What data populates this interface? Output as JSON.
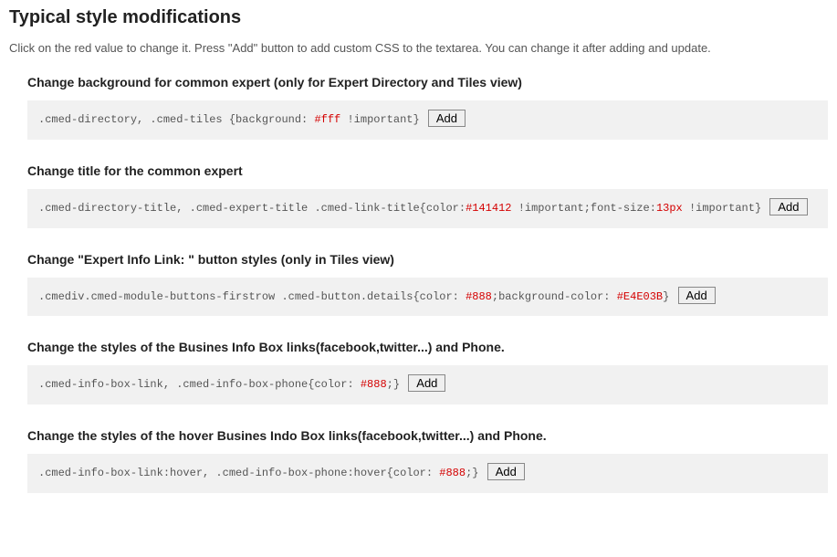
{
  "page": {
    "title": "Typical style modifications",
    "intro": "Click on the red value to change it. Press \"Add\" button to add custom CSS to the textarea. You can change it after adding and update."
  },
  "buttons": {
    "add": "Add"
  },
  "sections": [
    {
      "title": "Change background for common expert (only for Expert Directory and Tiles view)",
      "fragments": [
        {
          "type": "text",
          "value": ".cmed-directory, .cmed-tiles {background: "
        },
        {
          "type": "red",
          "value": "#fff"
        },
        {
          "type": "text",
          "value": " !important}"
        }
      ]
    },
    {
      "title": "Change title for the common expert",
      "fragments": [
        {
          "type": "text",
          "value": ".cmed-directory-title, .cmed-expert-title .cmed-link-title{color:"
        },
        {
          "type": "red",
          "value": "#141412"
        },
        {
          "type": "text",
          "value": " !important;font-size:"
        },
        {
          "type": "red",
          "value": "13px"
        },
        {
          "type": "text",
          "value": " !important}"
        }
      ]
    },
    {
      "title": "Change \"Expert Info Link: \" button styles (only in Tiles view)",
      "fragments": [
        {
          "type": "text",
          "value": ".cmediv.cmed-module-buttons-firstrow .cmed-button.details{color: "
        },
        {
          "type": "red",
          "value": "#888"
        },
        {
          "type": "text",
          "value": ";background-color: "
        },
        {
          "type": "red",
          "value": "#E4E03B"
        },
        {
          "type": "text",
          "value": "}"
        }
      ]
    },
    {
      "title": "Change the styles of the Busines Info Box links(facebook,twitter...) and Phone.",
      "fragments": [
        {
          "type": "text",
          "value": ".cmed-info-box-link, .cmed-info-box-phone{color: "
        },
        {
          "type": "red",
          "value": "#888"
        },
        {
          "type": "text",
          "value": ";}"
        }
      ]
    },
    {
      "title": "Change the styles of the hover Busines Indo Box links(facebook,twitter...) and Phone.",
      "fragments": [
        {
          "type": "text",
          "value": ".cmed-info-box-link:hover, .cmed-info-box-phone:hover{color: "
        },
        {
          "type": "red",
          "value": "#888"
        },
        {
          "type": "text",
          "value": ";}"
        }
      ]
    }
  ]
}
